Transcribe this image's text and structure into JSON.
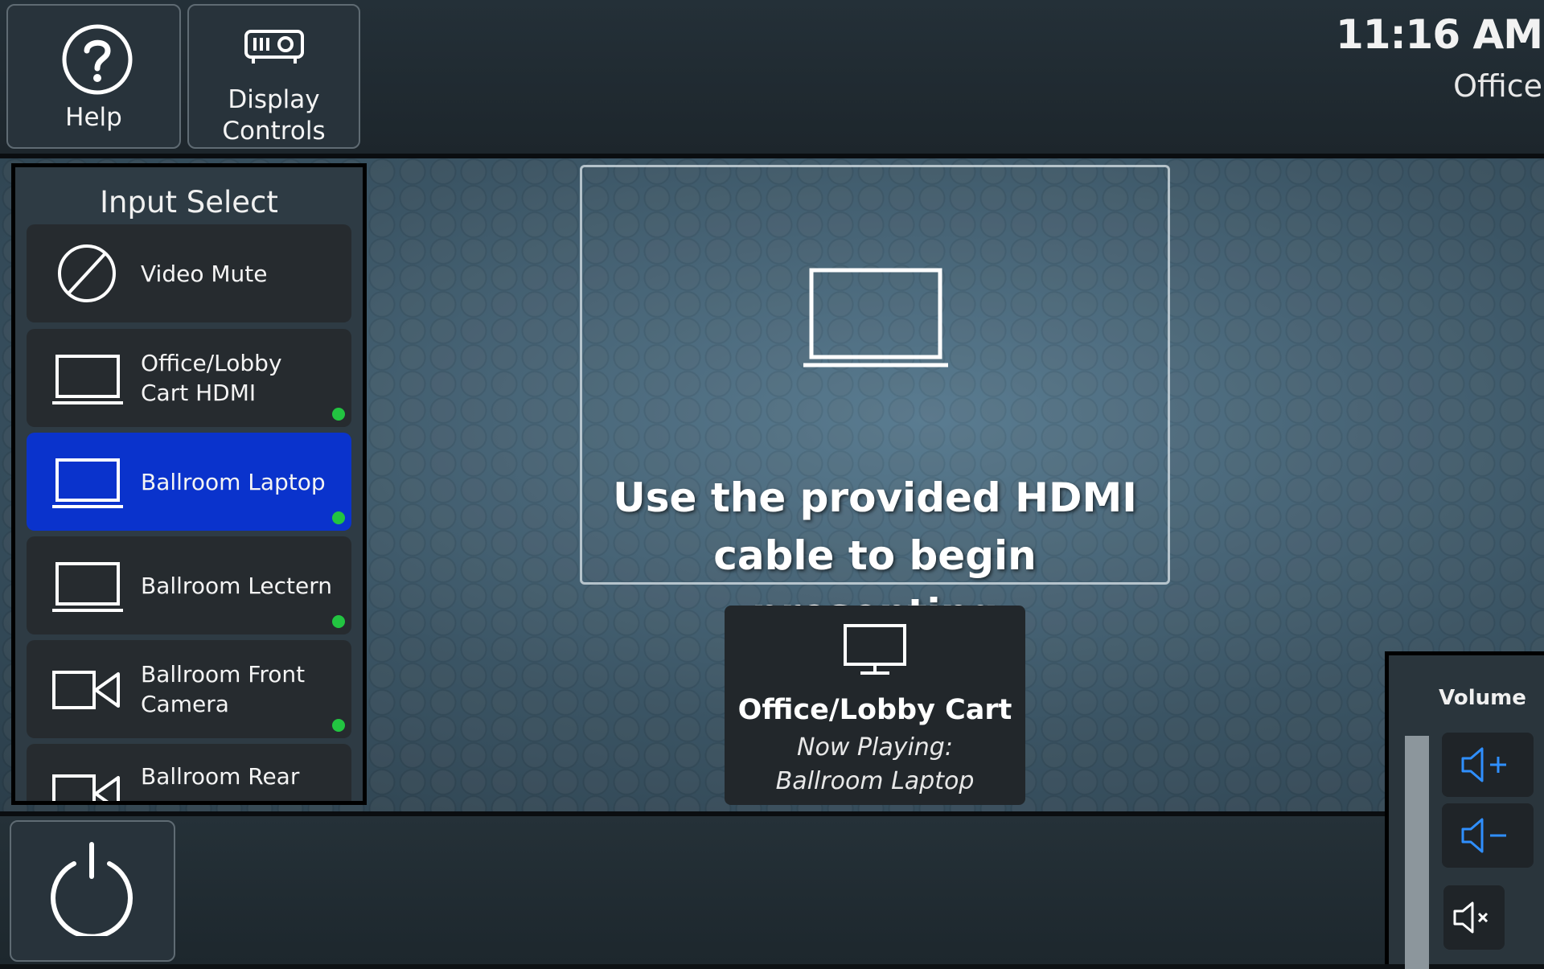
{
  "header": {
    "help_label": "Help",
    "display_controls_label": "Display\nControls",
    "time": "11:16 AM",
    "room": "Office"
  },
  "input_select": {
    "title": "Input Select",
    "sources": [
      {
        "label": "Video Mute",
        "icon": "video-mute-icon",
        "active": false,
        "signal": false
      },
      {
        "label": "Office/Lobby Cart HDMI",
        "icon": "laptop-icon",
        "active": false,
        "signal": true
      },
      {
        "label": "Ballroom Laptop",
        "icon": "laptop-icon",
        "active": true,
        "signal": true
      },
      {
        "label": "Ballroom Lectern",
        "icon": "laptop-icon",
        "active": false,
        "signal": true
      },
      {
        "label": "Ballroom Front Camera",
        "icon": "camera-icon",
        "active": false,
        "signal": true
      },
      {
        "label": "Ballroom Rear",
        "icon": "camera-icon",
        "active": false,
        "signal": false
      }
    ]
  },
  "message": {
    "text": "Use the provided HDMI cable to begin presenting",
    "icon": "laptop-icon"
  },
  "display_status": {
    "icon": "monitor-icon",
    "title": "Office/Lobby Cart",
    "now_playing": "Now Playing: Ballroom Laptop"
  },
  "volume": {
    "title": "Volume",
    "up_icon": "volume-up-icon",
    "down_icon": "volume-down-icon",
    "mute_icon": "volume-mute-icon"
  },
  "power": {
    "icon": "power-icon"
  },
  "colors": {
    "active_source": "#0a33cc",
    "signal_dot": "#22c441",
    "volume_icon": "#2f8fff"
  }
}
